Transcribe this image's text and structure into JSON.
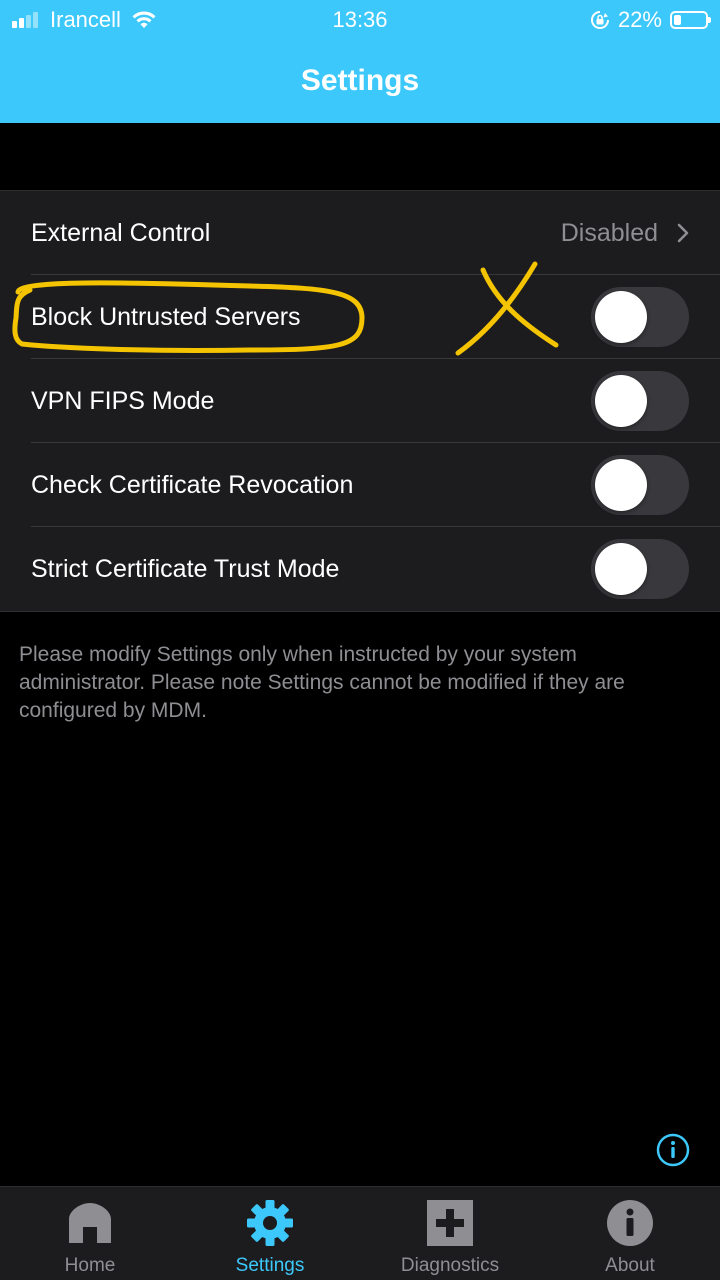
{
  "status_bar": {
    "carrier": "Irancell",
    "time": "13:36",
    "battery_percent": "22%",
    "battery_level": 0.22,
    "signal_bars_filled": 2,
    "signal_bars_total": 4
  },
  "header": {
    "title": "Settings",
    "background_color": "#3cc8fa"
  },
  "settings": {
    "external_control": {
      "label": "External Control",
      "value": "Disabled"
    },
    "block_untrusted_servers": {
      "label": "Block Untrusted Servers",
      "enabled": false
    },
    "vpn_fips_mode": {
      "label": "VPN FIPS Mode",
      "enabled": false
    },
    "check_certificate_revocation": {
      "label": "Check Certificate Revocation",
      "enabled": false
    },
    "strict_certificate_trust_mode": {
      "label": "Strict Certificate Trust Mode",
      "enabled": false
    }
  },
  "footnote": "Please modify Settings only when instructed by your system administrator. Please note Settings cannot be modified if they are configured by MDM.",
  "annotation": {
    "color": "#f5c400",
    "mark": "X"
  },
  "tabbar": {
    "active_color": "#3cc8fa",
    "tabs": [
      {
        "label": "Home",
        "icon": "home-icon",
        "active": false
      },
      {
        "label": "Settings",
        "icon": "gear-icon",
        "active": true
      },
      {
        "label": "Diagnostics",
        "icon": "diagnostics-plus-icon",
        "active": false
      },
      {
        "label": "About",
        "icon": "info-icon",
        "active": false
      }
    ]
  }
}
